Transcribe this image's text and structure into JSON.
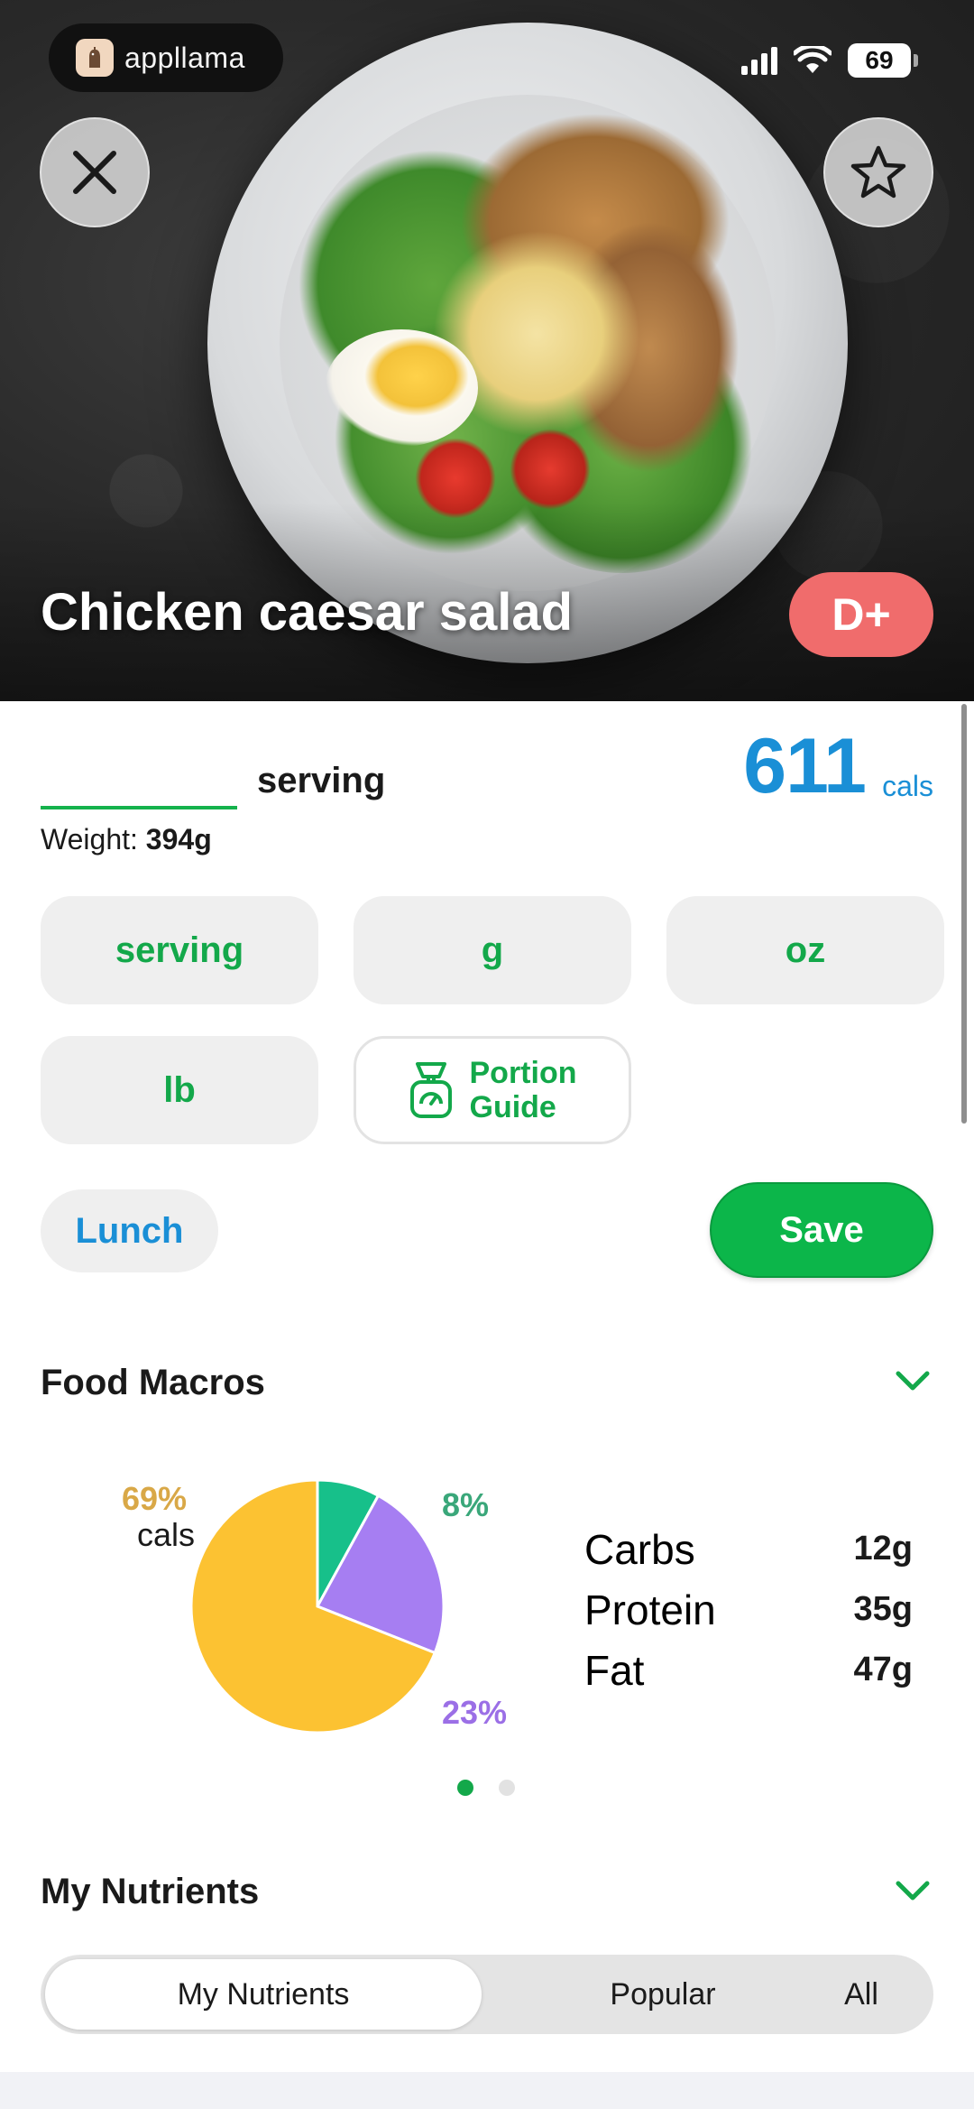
{
  "status_bar": {
    "brand": "appllama",
    "battery": "69"
  },
  "hero": {
    "food_name": "Chicken caesar salad",
    "grade": "D+"
  },
  "portion": {
    "quantity_value": "",
    "unit": "serving",
    "weight_label": "Weight:",
    "weight_value": "394g",
    "calories": "611",
    "calories_unit": "cals"
  },
  "unit_options": [
    "serving",
    "g",
    "oz",
    "lb"
  ],
  "portion_guide": {
    "line1": "Portion",
    "line2": "Guide"
  },
  "meal": "Lunch",
  "save_label": "Save",
  "food_macros": {
    "title": "Food Macros",
    "cals_percent": "69%",
    "cals_label": "cals",
    "carbs_percent": "8%",
    "protein_percent": "23%",
    "macros": [
      {
        "name": "Carbs",
        "value": "12g",
        "color": "#3aa77a"
      },
      {
        "name": "Protein",
        "value": "35g",
        "color": "#9b6fe6"
      },
      {
        "name": "Fat",
        "value": "47g",
        "color": "#d9a847"
      }
    ]
  },
  "chart_data": {
    "type": "pie",
    "categories": [
      "Carbs",
      "Protein",
      "Fat"
    ],
    "values": [
      8,
      23,
      69
    ],
    "colors": [
      "#17c08a",
      "#a67ef2",
      "#fcc232"
    ]
  },
  "pager": {
    "pages": 2,
    "active": 1
  },
  "my_nutrients": {
    "title": "My Nutrients",
    "tabs": [
      "My Nutrients",
      "Popular",
      "All"
    ],
    "active_tab": "My Nutrients"
  },
  "colors": {
    "accent_green": "#0cb64a",
    "accent_blue": "#1a8fd6",
    "grade_red": "#f06c6c"
  }
}
